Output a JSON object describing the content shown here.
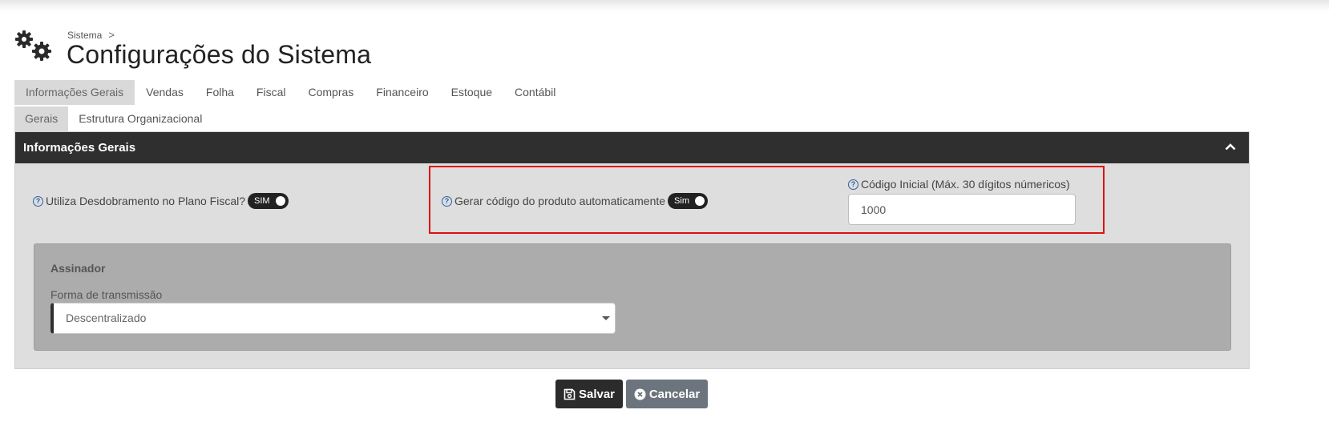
{
  "breadcrumb": {
    "root": "Sistema",
    "separator": ">"
  },
  "page_title": "Configurações do Sistema",
  "tabs": [
    {
      "label": "Informações Gerais",
      "active": true
    },
    {
      "label": "Vendas"
    },
    {
      "label": "Folha"
    },
    {
      "label": "Fiscal"
    },
    {
      "label": "Compras"
    },
    {
      "label": "Financeiro"
    },
    {
      "label": "Estoque"
    },
    {
      "label": "Contábil"
    }
  ],
  "subtabs": [
    {
      "label": "Gerais",
      "active": true
    },
    {
      "label": "Estrutura Organizacional"
    }
  ],
  "panel": {
    "title": "Informações Gerais",
    "field_desdobramento": {
      "label": "Utiliza Desdobramento no Plano Fiscal?",
      "toggle": "SIM"
    },
    "field_gerar_codigo": {
      "label": "Gerar código do produto automaticamente",
      "toggle": "Sim"
    },
    "field_codigo_inicial": {
      "label": "Código Inicial (Máx. 30 dígitos númericos)",
      "value": "1000"
    },
    "assinador": {
      "title": "Assinador",
      "forma_label": "Forma de transmissão",
      "forma_value": "Descentralizado"
    }
  },
  "buttons": {
    "save": "Salvar",
    "cancel": "Cancelar"
  },
  "help_glyph": "?",
  "colors": {
    "highlight": "#e01010",
    "header_bg": "#2f2f2f",
    "help": "#2c5fa8"
  }
}
